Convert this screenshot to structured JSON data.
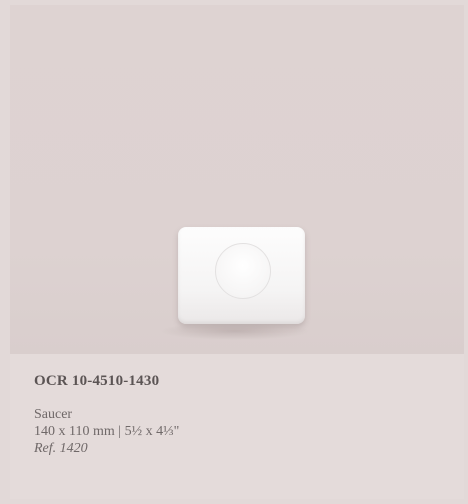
{
  "product": {
    "code": "OCR 10-4510-1430",
    "name": "Saucer",
    "dimensions": "140 x 110 mm | 5½ x 4⅓\"",
    "ref": "Ref. 1420"
  },
  "colors": {
    "background": "#e2d9d8",
    "image_area": "#ded3d2",
    "info_panel": "#e4dbda",
    "code_text": "#5b5454",
    "body_text": "#6f6868"
  },
  "icons": {
    "product_image": "white rectangular saucer"
  }
}
